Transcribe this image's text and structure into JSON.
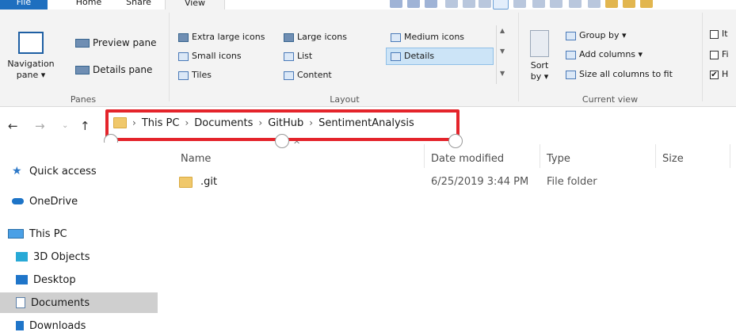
{
  "tabs": {
    "file": "File",
    "home": "Home",
    "share": "Share",
    "view": "View"
  },
  "ribbon": {
    "panes": {
      "navigation_pane": "Navigation",
      "navigation_pane_sub": "pane",
      "preview_pane": "Preview pane",
      "details_pane": "Details pane",
      "group_label": "Panes"
    },
    "layout": {
      "extra_large_icons": "Extra large icons",
      "large_icons": "Large icons",
      "medium_icons": "Medium icons",
      "small_icons": "Small icons",
      "list": "List",
      "details": "Details",
      "tiles": "Tiles",
      "content": "Content",
      "group_label": "Layout",
      "selected": "Details"
    },
    "current_view": {
      "sort_by": "Sort",
      "sort_by_sub": "by",
      "group_by": "Group by",
      "add_columns": "Add columns",
      "size_all_columns": "Size all columns to fit",
      "group_label": "Current view"
    },
    "show_hide": {
      "items": [
        "It",
        "Fi",
        "H"
      ],
      "checked": [
        false,
        false,
        true
      ]
    }
  },
  "address_bar": {
    "crumbs": [
      "This PC",
      "Documents",
      "GitHub",
      "SentimentAnalysis"
    ]
  },
  "nav_pane": {
    "items": [
      {
        "label": "Quick access",
        "icon": "star-icon"
      },
      {
        "label": "OneDrive",
        "icon": "cloud-icon"
      },
      {
        "label": "This PC",
        "icon": "computer-icon"
      },
      {
        "label": "3D Objects",
        "icon": "cube-icon"
      },
      {
        "label": "Desktop",
        "icon": "desktop-icon"
      },
      {
        "label": "Documents",
        "icon": "document-icon"
      },
      {
        "label": "Downloads",
        "icon": "download-icon"
      }
    ],
    "selected": "Documents"
  },
  "file_list": {
    "columns": [
      "Name",
      "Date modified",
      "Type",
      "Size"
    ],
    "rows": [
      {
        "name": ".git",
        "date_modified": "6/25/2019 3:44 PM",
        "type": "File folder",
        "size": ""
      }
    ]
  },
  "colors": {
    "accent": "#1e6fbf",
    "highlight_box": "#e4242b",
    "selected_bg": "#cce4f7",
    "folder": "#f0c86b"
  }
}
